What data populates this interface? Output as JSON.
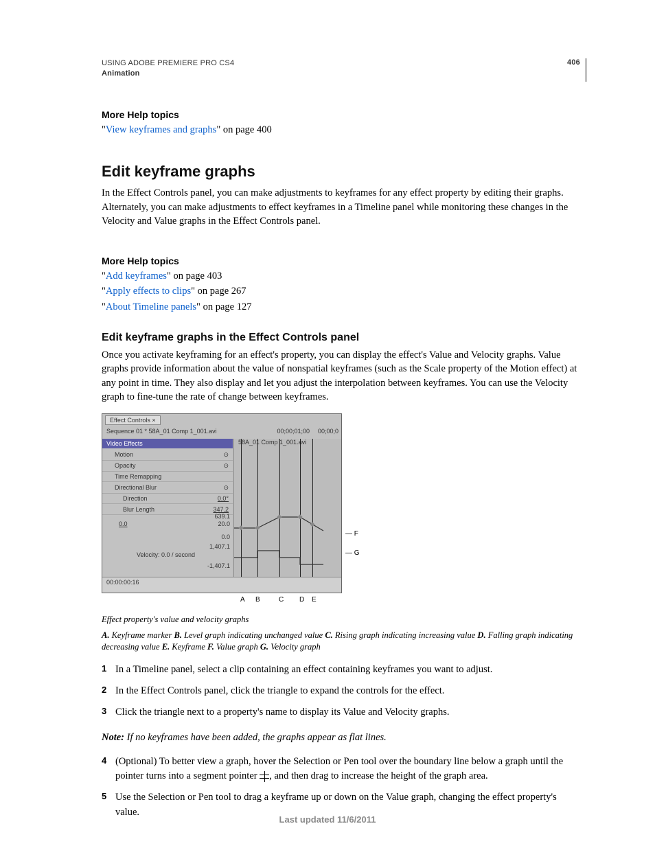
{
  "header": {
    "product": "USING ADOBE PREMIERE PRO CS4",
    "section": "Animation",
    "page": "406"
  },
  "moreHelp1": {
    "title": "More Help topics",
    "link": "View keyframes and graphs",
    "tail": "\" on page 400"
  },
  "h2": "Edit keyframe graphs",
  "para1": "In the Effect Controls panel, you can make adjustments to keyframes for any effect property by editing their graphs. Alternately, you can make adjustments to effect keyframes in a Timeline panel while monitoring these changes in the Velocity and Value graphs in the Effect Controls panel.",
  "moreHelp2": {
    "title": "More Help topics",
    "links": [
      {
        "text": "Add keyframes",
        "tail": "\" on page 403"
      },
      {
        "text": "Apply effects to clips",
        "tail": "\" on page 267"
      },
      {
        "text": "About Timeline panels",
        "tail": "\" on page 127"
      }
    ]
  },
  "h3": "Edit keyframe graphs in the Effect Controls panel",
  "para2": "Once you activate keyframing for an effect's property, you can display the effect's Value and Velocity graphs. Value graphs provide information about the value of nonspatial keyframes (such as the Scale property of the Motion effect) at any point in time. They also display and let you adjust the interpolation between keyframes. You can use the Velocity graph to fine-tune the rate of change between keyframes.",
  "figure": {
    "tab": "Effect Controls ×",
    "sequence": "Sequence 01 * 58A_01 Comp 1_001.avi",
    "clip": "58A_01 Comp 1_001.avi",
    "timecodeTop": "00;00;01;00",
    "timecodeTop2": "00;00;0",
    "barVideoEffects": "Video Effects",
    "rowMotion": "Motion",
    "rowOpacity": "Opacity",
    "rowTimeRemap": "Time Remapping",
    "rowDirBlur": "Directional Blur",
    "rowDirection": "Direction",
    "rowDirectionVal": "0.0°",
    "rowBlurLen": "Blur Length",
    "rowBlurLenVal": "347.2",
    "valTop": "639.1",
    "valMid": "20.0",
    "val0": "0.0",
    "valZero": "0.0",
    "valVelHi": "1,407.1",
    "valVelLo": "-1,407.1",
    "velocityLabel": "Velocity: 0.0 / second",
    "bottomTime": "00:00:00:16",
    "outF": "F",
    "outG": "G",
    "outA": "A",
    "outB": "B",
    "outC": "C",
    "outD": "D",
    "outE": "E"
  },
  "captionTitle": "Effect property's value and velocity graphs",
  "captionA": "A.",
  "captionAText": " Keyframe marker  ",
  "captionB": "B.",
  "captionBText": " Level graph indicating unchanged value  ",
  "captionC": "C.",
  "captionCText": " Rising graph indicating increasing value  ",
  "captionD": "D.",
  "captionDText": " Falling graph indicating decreasing value  ",
  "captionE": "E.",
  "captionEText": " Keyframe  ",
  "captionF": "F.",
  "captionFText": " Value graph  ",
  "captionG": "G.",
  "captionGText": " Velocity graph",
  "steps": [
    "In a Timeline panel, select a clip containing an effect containing keyframes you want to adjust.",
    "In the Effect Controls panel, click the triangle to expand the controls for the effect.",
    " Click the triangle next to a property's name to display its Value and Velocity graphs."
  ],
  "noteLabel": "Note:",
  "noteText": " If no keyframes have been added, the graphs appear as flat lines.",
  "step4a": "(Optional) To better view a graph, hover the Selection or Pen tool over the boundary line below a graph until the pointer turns into a segment pointer ",
  "step4b": ", and then drag to increase the height of the graph area.",
  "step5": "Use the Selection or Pen tool to drag a keyframe up or down on the Value graph, changing the effect property's value.",
  "footer": "Last updated 11/6/2011"
}
